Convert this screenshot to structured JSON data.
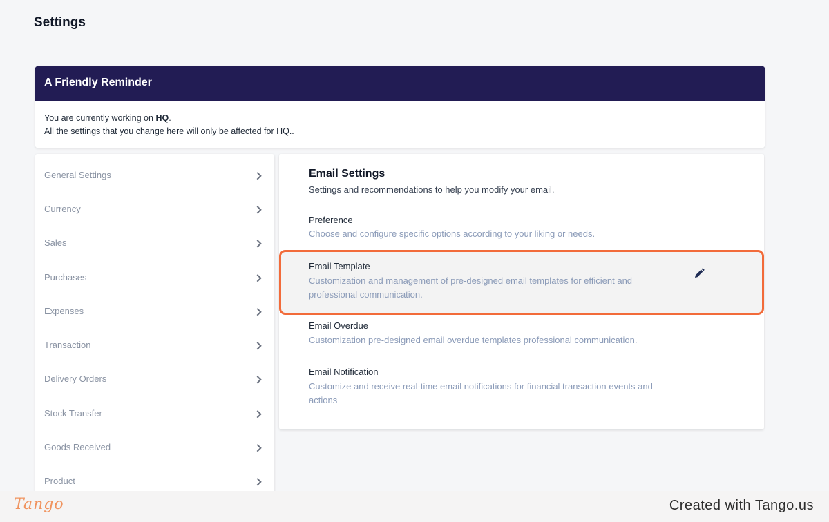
{
  "page": {
    "title": "Settings"
  },
  "reminder": {
    "heading": "A Friendly Reminder",
    "line1_prefix": "You are currently working on ",
    "line1_bold": "HQ",
    "line1_suffix": ".",
    "line2": "All the settings that you change here will only be affected for HQ.."
  },
  "sidebar": {
    "items": [
      {
        "label": "General Settings"
      },
      {
        "label": "Currency"
      },
      {
        "label": "Sales"
      },
      {
        "label": "Purchases"
      },
      {
        "label": "Expenses"
      },
      {
        "label": "Transaction"
      },
      {
        "label": "Delivery Orders"
      },
      {
        "label": "Stock Transfer"
      },
      {
        "label": "Goods Received"
      },
      {
        "label": "Product"
      }
    ]
  },
  "email_settings": {
    "title": "Email Settings",
    "subtitle": "Settings and recommendations to help you modify your email.",
    "options": [
      {
        "title": "Preference",
        "desc": "Choose and configure specific options according to your liking or needs."
      },
      {
        "title": "Email Template",
        "desc": "Customization and management of pre-designed email templates for efficient and professional communication."
      },
      {
        "title": "Email Overdue",
        "desc": "Customization pre-designed email overdue templates professional communication."
      },
      {
        "title": "Email Notification",
        "desc": "Customize and receive real-time email notifications for financial transaction events and actions"
      }
    ]
  },
  "icons": {
    "edit": "pencil-icon",
    "chevron": "chevron-right-icon"
  },
  "colors": {
    "header_bg": "#221c54",
    "highlight_border": "#f26b3a",
    "desc_text": "#8b9bb8",
    "tango_accent": "#f0935e"
  },
  "footer": {
    "logo_text": "Tango",
    "created_text": "Created with Tango.us"
  }
}
